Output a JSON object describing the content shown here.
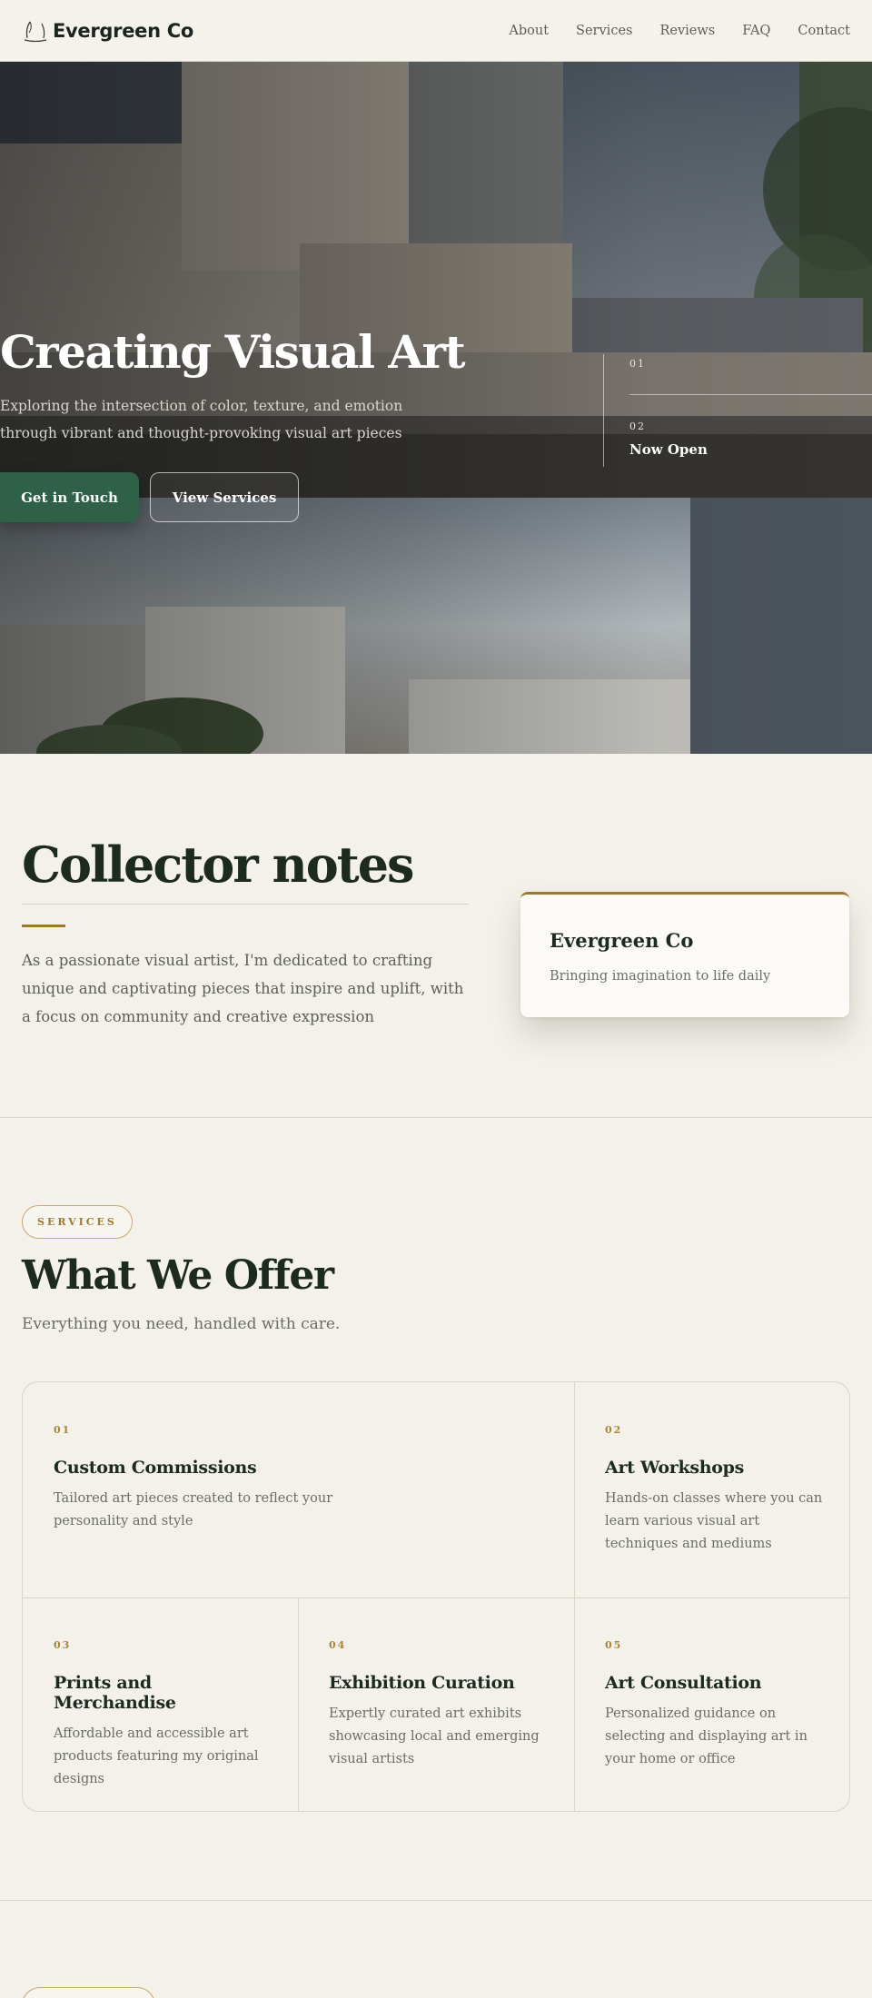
{
  "nav": {
    "brand": "Evergreen Co",
    "links": [
      "About",
      "Services",
      "Reviews",
      "FAQ",
      "Contact"
    ]
  },
  "hero": {
    "title": "Creating Visual Art",
    "subtitle": "Exploring the intersection of color, texture, and emotion through vibrant and thought-provoking visual art pieces",
    "primary_cta": "Get in Touch",
    "secondary_cta": "View Services",
    "stat_1_num": "01",
    "stat_2_num": "02",
    "stat_2_label": "Now Open"
  },
  "notes": {
    "title": "Collector notes",
    "body": "As a passionate visual artist, I'm dedicated to crafting unique and captivating pieces that inspire and uplift, with a focus on community and creative expression",
    "card_name": "Evergreen Co",
    "card_tagline": "Bringing imagination to life daily"
  },
  "services": {
    "eyebrow": "SERVICES",
    "title": "What We Offer",
    "subtitle": "Everything you need, handled with care.",
    "items": [
      {
        "num": "01",
        "title": "Custom Commissions",
        "desc": "Tailored art pieces created to reflect your personality and style"
      },
      {
        "num": "02",
        "title": "Art Workshops",
        "desc": "Hands-on classes where you can learn various visual art techniques and mediums"
      },
      {
        "num": "03",
        "title": "Prints and Merchandise",
        "desc": "Affordable and accessible art products featuring my original designs"
      },
      {
        "num": "04",
        "title": "Exhibition Curation",
        "desc": "Expertly curated art exhibits showcasing local and emerging visual artists"
      },
      {
        "num": "05",
        "title": "Art Consultation",
        "desc": "Personalized guidance on selecting and displaying art in your home or office"
      }
    ]
  },
  "colors": {
    "background": "#f3f1ea",
    "accent_gold": "#9b7a2f",
    "primary_green": "#2f6148",
    "heading": "#1c2a20"
  }
}
